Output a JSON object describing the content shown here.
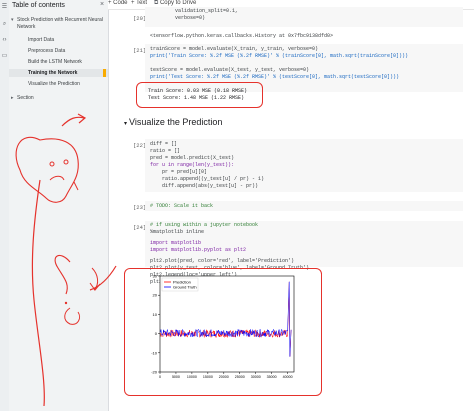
{
  "toolbar": {
    "code_label": "+ Code",
    "text_label": "+ Text",
    "drive_label": "Copy to Drive"
  },
  "sidebar": {
    "title": "Table of contents",
    "close": "×",
    "items": [
      {
        "label": "Stock Prediction with Recurrent Neural"
      },
      {
        "label": "Network"
      },
      {
        "label": "Import Data"
      },
      {
        "label": "Preprocess Data"
      },
      {
        "label": "Build the LSTM Network"
      },
      {
        "label": "Training the Network"
      },
      {
        "label": "Visualize the Prediction"
      },
      {
        "label": "Section"
      }
    ]
  },
  "cells": {
    "c20": {
      "num": "[20]",
      "line1": "validation_split=0.1,",
      "line2": "verbose=0)",
      "output": "<tensorflow.python.keras.callbacks.History at 0x7fbc9138dfd0>"
    },
    "c21": {
      "num": "[21]",
      "l1": "trainScore = model.evaluate(X_train, y_train, verbose=0)",
      "l2": "print('Train Score: %.2f MSE (%.2f RMSE)' % (trainScore[0], math.sqrt(trainScore[0])))",
      "l3": "testScore = model.evaluate(X_test, y_test, verbose=0)",
      "l4": "print('Test Score: %.2f MSE (%.2f RMSE)' % (testScore[0], math.sqrt(testScore[0])))",
      "out1": "Train Score: 0.03 MSE (0.18 RMSE)",
      "out2": "Test Score: 1.48 MSE (1.22 RMSE)"
    },
    "section": "Visualize the Prediction",
    "c22": {
      "num": "[22]",
      "l1": "diff = []",
      "l2": "ratio = []",
      "l3": "pred = model.predict(X_test)",
      "l4": "for u in range(len(y_test)):",
      "l5": "    pr = pred[u][0]",
      "l6": "    ratio.append((y_test[u] / pr) - 1)",
      "l7": "    diff.append(abs(y_test[u] - pr))"
    },
    "c23": {
      "num": "[23]",
      "l1": "# TODO: Scale it back"
    },
    "c24": {
      "num": "[24]",
      "l1": "# if using within a jupyter notebook",
      "l2": "%matplotlib inline",
      "l3": "import matplotlib",
      "l4": "import matplotlib.pyplot as plt2",
      "l5": "plt2.plot(pred, color='red', label='Prediction')",
      "l6": "plt2.plot(y_test, color='blue', label='Ground Truth')",
      "l7": "plt2.legend(loc='upper left')",
      "l8": "plt2.show()"
    }
  },
  "chart_data": {
    "type": "line",
    "series": [
      {
        "name": "Prediction",
        "color": "#ff0000"
      },
      {
        "name": "Ground Truth",
        "color": "#0000ff"
      }
    ],
    "xlim": [
      0,
      42000
    ],
    "ylim": [
      -20,
      30
    ],
    "xticks": [
      0,
      5000,
      10000,
      15000,
      20000,
      25000,
      30000,
      35000,
      40000
    ],
    "yticks": [
      -20,
      -10,
      0,
      10,
      20,
      30
    ],
    "legend": "upper left",
    "approx_baseline": 0,
    "approx_noise": 2,
    "spike_x": 40500,
    "spike_range": [
      -12,
      27
    ]
  },
  "colors": {
    "annotation": "#e5322c",
    "toc_marker": "#f9ab00"
  }
}
